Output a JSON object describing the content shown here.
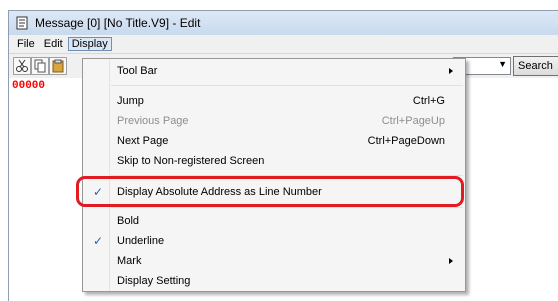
{
  "window": {
    "title": "Message [0] [No Title.V9] - Edit"
  },
  "menubar": {
    "file": "File",
    "edit": "Edit",
    "display": "Display"
  },
  "toolbar": {
    "search_label": "Search"
  },
  "editor": {
    "line_number": "00000"
  },
  "display_menu": {
    "tool_bar": "Tool Bar",
    "jump": "Jump",
    "jump_shortcut": "Ctrl+G",
    "previous_page": "Previous Page",
    "previous_page_shortcut": "Ctrl+PageUp",
    "next_page": "Next Page",
    "next_page_shortcut": "Ctrl+PageDown",
    "skip": "Skip to Non-registered Screen",
    "display_absolute": "Display Absolute Address as Line Number",
    "bold": "Bold",
    "underline": "Underline",
    "mark": "Mark",
    "display_setting": "Display Setting",
    "check_glyph": "✓"
  },
  "colors": {
    "highlight": "#e11b22",
    "line_number": "#ff0000",
    "check": "#2b5ea8"
  }
}
